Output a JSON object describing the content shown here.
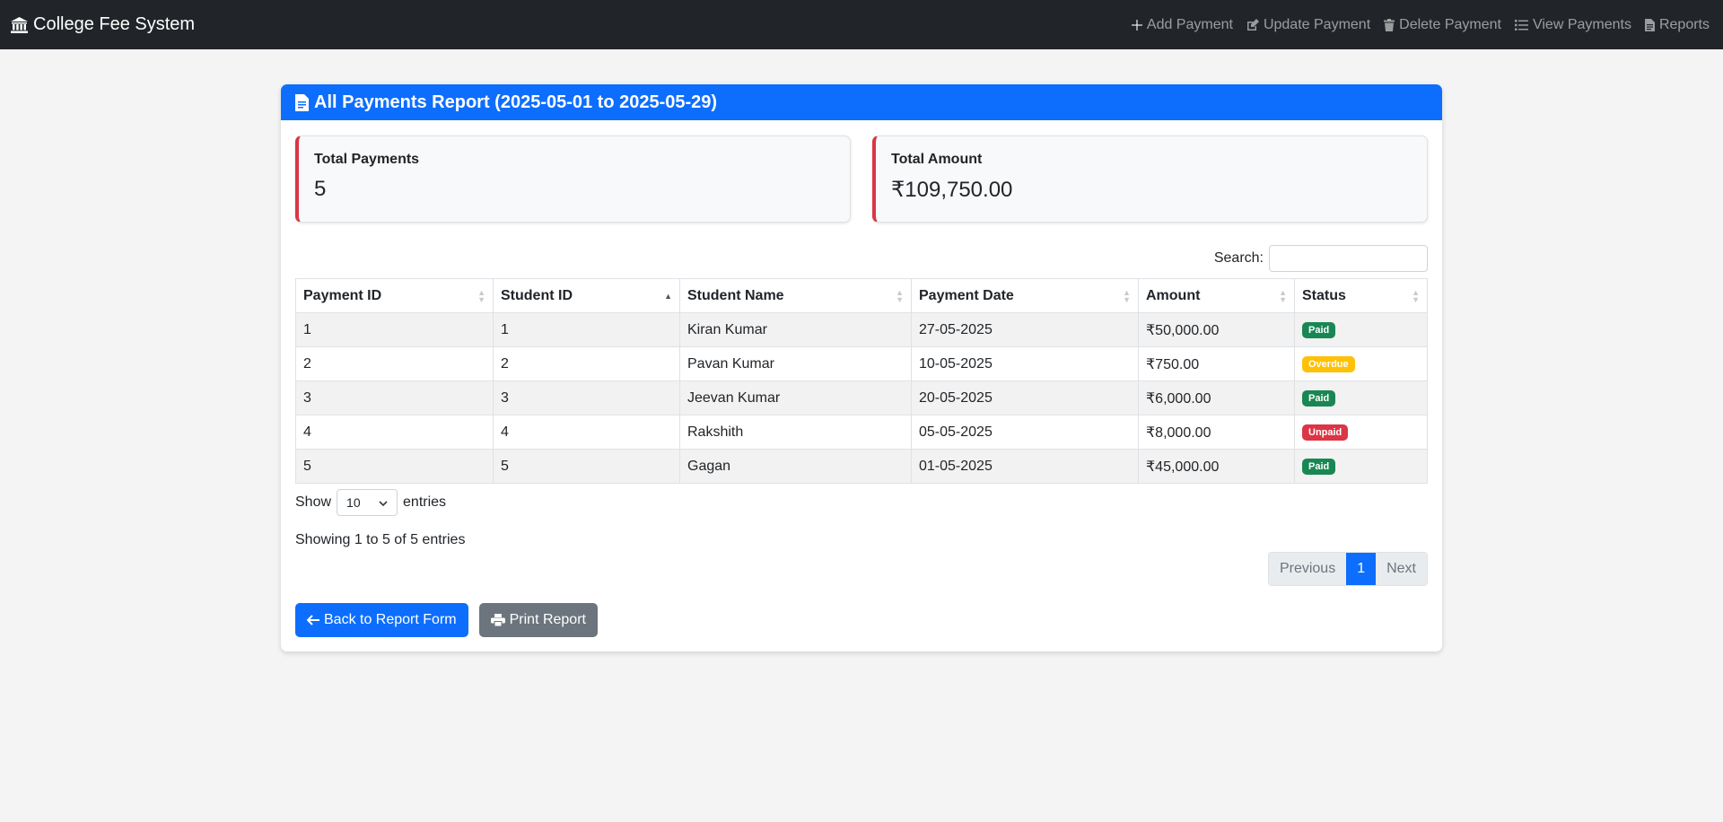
{
  "navbar": {
    "brand": "College Fee System",
    "links": [
      "Add Payment",
      "Update Payment",
      "Delete Payment",
      "View Payments",
      "Reports"
    ]
  },
  "report": {
    "title": "All Payments Report (2025-05-01 to 2025-05-29)",
    "total_payments_label": "Total Payments",
    "total_payments_value": "5",
    "total_amount_label": "Total Amount",
    "total_amount_value": "₹109,750.00",
    "search_label": "Search:",
    "search_value": "",
    "columns": [
      "Payment ID",
      "Student ID",
      "Student Name",
      "Payment Date",
      "Amount",
      "Status"
    ],
    "rows": [
      [
        "1",
        "1",
        "Kiran Kumar",
        "27-05-2025",
        "₹50,000.00",
        "Paid"
      ],
      [
        "2",
        "2",
        "Pavan Kumar",
        "10-05-2025",
        "₹750.00",
        "Overdue"
      ],
      [
        "3",
        "3",
        "Jeevan Kumar",
        "20-05-2025",
        "₹6,000.00",
        "Paid"
      ],
      [
        "4",
        "4",
        "Rakshith",
        "05-05-2025",
        "₹8,000.00",
        "Unpaid"
      ],
      [
        "5",
        "5",
        "Gagan",
        "01-05-2025",
        "₹45,000.00",
        "Paid"
      ]
    ],
    "show_label": "Show",
    "page_size": "10",
    "entries_label": "entries",
    "info": "Showing 1 to 5 of 5 entries",
    "pager": {
      "previous": "Previous",
      "current": "1",
      "next": "Next"
    },
    "back_button": "Back to Report Form",
    "print_button": "Print Report"
  },
  "colors": {
    "navbar_bg": "#212529",
    "primary": "#0d6efd",
    "danger": "#dc3545",
    "success": "#198754",
    "warning": "#ffc107",
    "secondary": "#6c757d"
  }
}
